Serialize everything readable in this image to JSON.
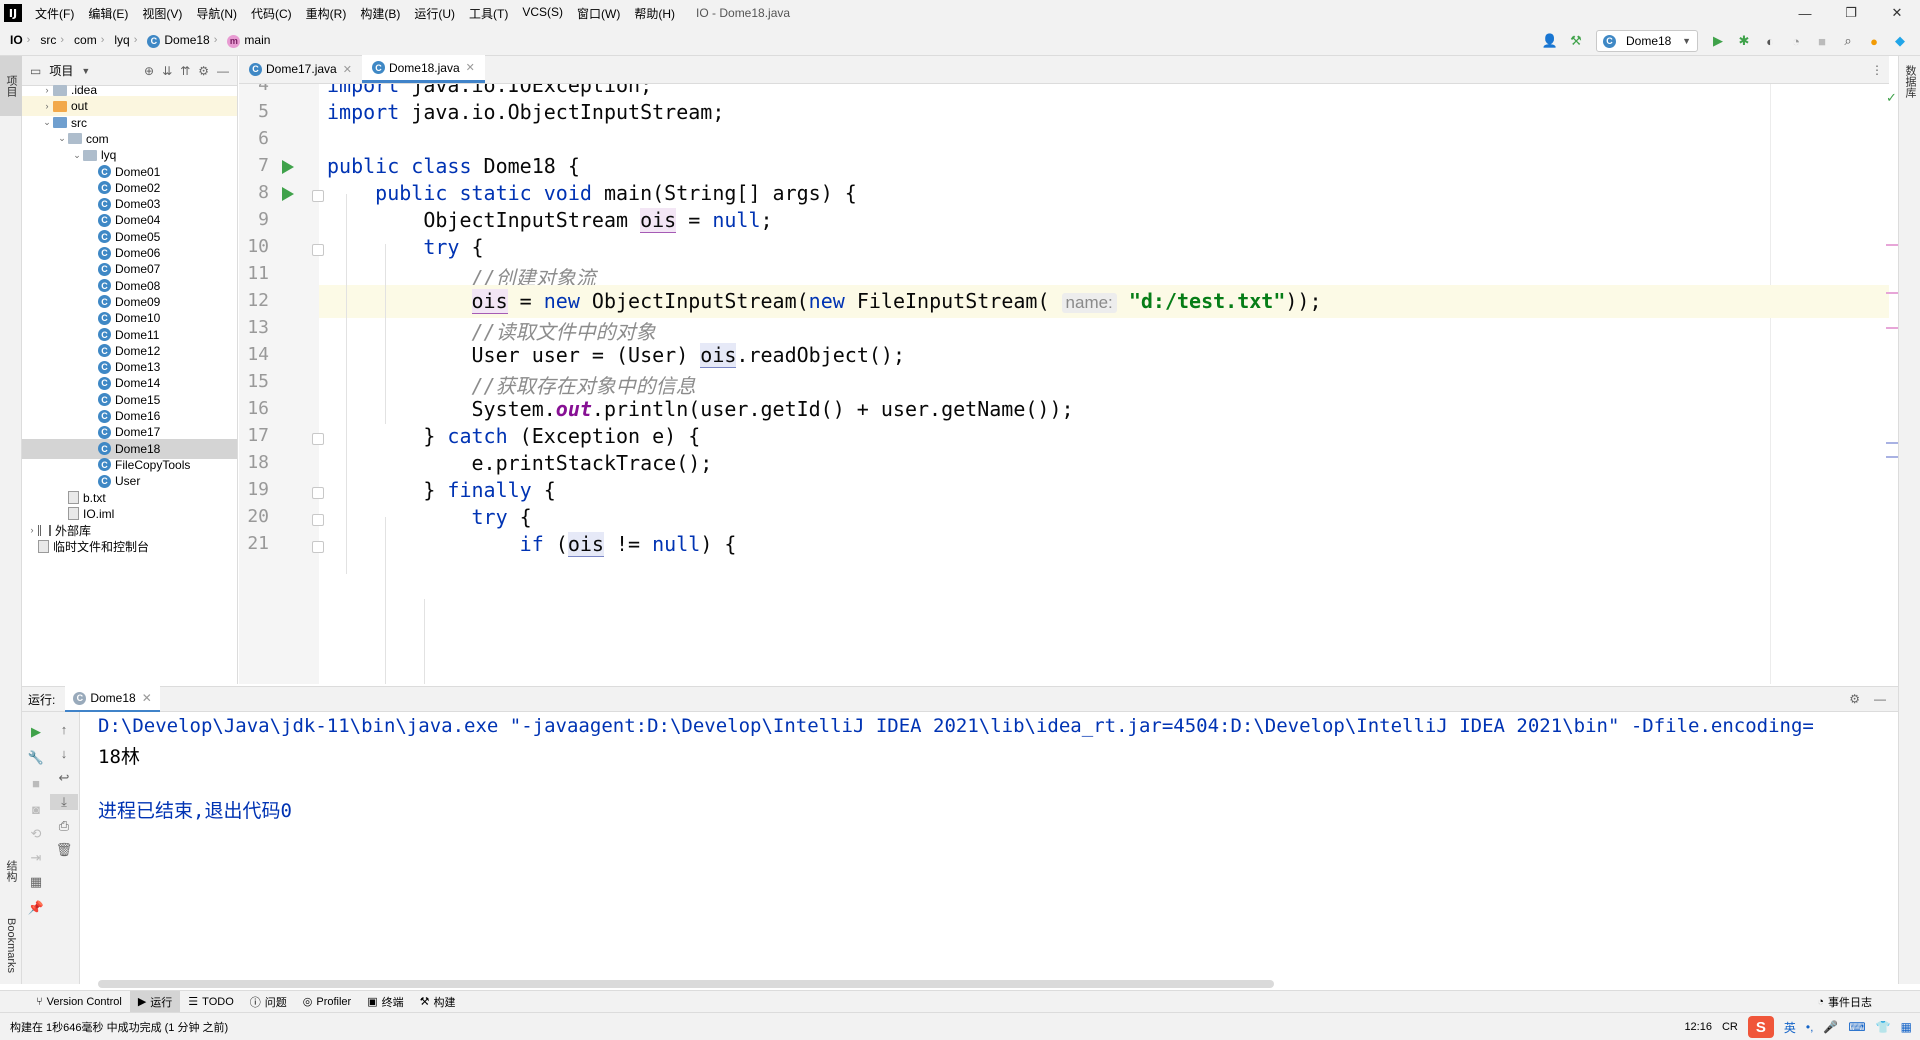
{
  "app": {
    "logo": "IJ",
    "title": "IO - Dome18.java"
  },
  "menu": [
    "文件(F)",
    "编辑(E)",
    "视图(V)",
    "导航(N)",
    "代码(C)",
    "重构(R)",
    "构建(B)",
    "运行(U)",
    "工具(T)",
    "VCS(S)",
    "窗口(W)",
    "帮助(H)"
  ],
  "window_controls": {
    "minimize": "—",
    "maximize": "❐",
    "close": "✕"
  },
  "breadcrumb": [
    {
      "label": "IO",
      "icon": "none"
    },
    {
      "label": "src",
      "icon": "none"
    },
    {
      "label": "com",
      "icon": "none"
    },
    {
      "label": "lyq",
      "icon": "none"
    },
    {
      "label": "Dome18",
      "icon": "class-icon"
    },
    {
      "label": "main",
      "icon": "method-icon"
    }
  ],
  "run_config": {
    "label": "Dome18"
  },
  "left_stripe": {
    "project_label": "项目",
    "structure_label": "结构",
    "bookmarks_label": "Bookmarks"
  },
  "right_stripe": {
    "database_label": "数据库"
  },
  "project_panel": {
    "title": "项目",
    "tree": [
      {
        "label": ".idea",
        "kind": "folder",
        "indent": 1,
        "arrow": "›",
        "state": ""
      },
      {
        "label": "out",
        "kind": "folder-orange",
        "indent": 1,
        "arrow": "›",
        "state": "hl"
      },
      {
        "label": "src",
        "kind": "folder-blue",
        "indent": 1,
        "arrow": "⌄",
        "state": ""
      },
      {
        "label": "com",
        "kind": "folder",
        "indent": 2,
        "arrow": "⌄",
        "state": ""
      },
      {
        "label": "lyq",
        "kind": "folder",
        "indent": 3,
        "arrow": "⌄",
        "state": ""
      },
      {
        "label": "Dome01",
        "kind": "class",
        "indent": 4,
        "arrow": "",
        "state": ""
      },
      {
        "label": "Dome02",
        "kind": "class",
        "indent": 4,
        "arrow": "",
        "state": ""
      },
      {
        "label": "Dome03",
        "kind": "class",
        "indent": 4,
        "arrow": "",
        "state": ""
      },
      {
        "label": "Dome04",
        "kind": "class",
        "indent": 4,
        "arrow": "",
        "state": ""
      },
      {
        "label": "Dome05",
        "kind": "class",
        "indent": 4,
        "arrow": "",
        "state": ""
      },
      {
        "label": "Dome06",
        "kind": "class",
        "indent": 4,
        "arrow": "",
        "state": ""
      },
      {
        "label": "Dome07",
        "kind": "class",
        "indent": 4,
        "arrow": "",
        "state": ""
      },
      {
        "label": "Dome08",
        "kind": "class",
        "indent": 4,
        "arrow": "",
        "state": ""
      },
      {
        "label": "Dome09",
        "kind": "class",
        "indent": 4,
        "arrow": "",
        "state": ""
      },
      {
        "label": "Dome10",
        "kind": "class",
        "indent": 4,
        "arrow": "",
        "state": ""
      },
      {
        "label": "Dome11",
        "kind": "class",
        "indent": 4,
        "arrow": "",
        "state": ""
      },
      {
        "label": "Dome12",
        "kind": "class",
        "indent": 4,
        "arrow": "",
        "state": ""
      },
      {
        "label": "Dome13",
        "kind": "class",
        "indent": 4,
        "arrow": "",
        "state": ""
      },
      {
        "label": "Dome14",
        "kind": "class",
        "indent": 4,
        "arrow": "",
        "state": ""
      },
      {
        "label": "Dome15",
        "kind": "class",
        "indent": 4,
        "arrow": "",
        "state": ""
      },
      {
        "label": "Dome16",
        "kind": "class",
        "indent": 4,
        "arrow": "",
        "state": ""
      },
      {
        "label": "Dome17",
        "kind": "class",
        "indent": 4,
        "arrow": "",
        "state": ""
      },
      {
        "label": "Dome18",
        "kind": "class",
        "indent": 4,
        "arrow": "",
        "state": "sel"
      },
      {
        "label": "FileCopyTools",
        "kind": "class",
        "indent": 4,
        "arrow": "",
        "state": ""
      },
      {
        "label": "User",
        "kind": "class",
        "indent": 4,
        "arrow": "",
        "state": ""
      },
      {
        "label": "b.txt",
        "kind": "file",
        "indent": 2,
        "arrow": "",
        "state": ""
      },
      {
        "label": "IO.iml",
        "kind": "file",
        "indent": 2,
        "arrow": "",
        "state": ""
      },
      {
        "label": "外部库",
        "kind": "lib",
        "indent": 0,
        "arrow": "›",
        "state": ""
      },
      {
        "label": "临时文件和控制台",
        "kind": "scratch",
        "indent": 0,
        "arrow": "",
        "state": ""
      }
    ]
  },
  "editor_tabs": [
    {
      "label": "Dome17.java",
      "active": false
    },
    {
      "label": "Dome18.java",
      "active": true
    }
  ],
  "editor": {
    "current_line": 12,
    "lines": [
      {
        "n": "4",
        "run": false,
        "fold": false,
        "html": "<span class=\"kw\">import</span> java.io.IOException;"
      },
      {
        "n": "5",
        "run": false,
        "fold": false,
        "html": "<span class=\"kw\">import</span> java.io.ObjectInputStream;"
      },
      {
        "n": "6",
        "run": false,
        "fold": false,
        "html": ""
      },
      {
        "n": "7",
        "run": true,
        "fold": false,
        "html": "<span class=\"kw\">public class</span> Dome18 {"
      },
      {
        "n": "8",
        "run": true,
        "fold": true,
        "html": "    <span class=\"kw\">public static void</span> main(String[] args) {"
      },
      {
        "n": "9",
        "run": false,
        "fold": false,
        "html": "        ObjectInputStream <span class=\"var\">ois</span> = <span class=\"kw\">null</span>;"
      },
      {
        "n": "10",
        "run": false,
        "fold": true,
        "html": "        <span class=\"kw\">try</span> {"
      },
      {
        "n": "11",
        "run": false,
        "fold": false,
        "html": "            <span class=\"cm\">//创建对象流</span>"
      },
      {
        "n": "12",
        "run": false,
        "fold": false,
        "html": "            <span class=\"var\">ois</span> = <span class=\"kw\">new</span> ObjectInputStream(<span class=\"kw\">new</span> FileInputStream( <span class=\"hint\">name:</span> <span class=\"str\">\"d:/test.txt\"</span>));"
      },
      {
        "n": "13",
        "run": false,
        "fold": false,
        "html": "            <span class=\"cm\">//读取文件中的对象</span>"
      },
      {
        "n": "14",
        "run": false,
        "fold": false,
        "html": "            User user = (User) <span class=\"var2\">ois</span>.readObject();"
      },
      {
        "n": "15",
        "run": false,
        "fold": false,
        "html": "            <span class=\"cm\">//获取存在对象中的信息</span>"
      },
      {
        "n": "16",
        "run": false,
        "fold": false,
        "html": "            System.<span class=\"it\">out</span>.println(user.getId() + user.getName());"
      },
      {
        "n": "17",
        "run": false,
        "fold": true,
        "html": "        } <span class=\"kw\">catch</span> (Exception e) {"
      },
      {
        "n": "18",
        "run": false,
        "fold": false,
        "html": "            e.printStackTrace();"
      },
      {
        "n": "19",
        "run": false,
        "fold": true,
        "html": "        } <span class=\"kw\">finally</span> {"
      },
      {
        "n": "20",
        "run": false,
        "fold": true,
        "html": "            <span class=\"kw\">try</span> {"
      },
      {
        "n": "21",
        "run": false,
        "fold": true,
        "html": "                <span class=\"kw\">if</span> (<span class=\"var2\">ois</span> != <span class=\"kw\">null</span>) {"
      }
    ]
  },
  "run_panel": {
    "label": "运行:",
    "tab_label": "Dome18",
    "console_lines": [
      {
        "text": "D:\\Develop\\Java\\jdk-11\\bin\\java.exe \"-javaagent:D:\\Develop\\IntelliJ IDEA 2021\\lib\\idea_rt.jar=4504:D:\\Develop\\IntelliJ IDEA 2021\\bin\" -Dfile.encoding=",
        "style": "blue"
      },
      {
        "text": "18林",
        "style": ""
      },
      {
        "text": "",
        "style": ""
      },
      {
        "text": "进程已结束,退出代码0",
        "style": "blue"
      }
    ]
  },
  "tool_windows": [
    {
      "label": "Version Control",
      "icon": "⑂",
      "active": false
    },
    {
      "label": "运行",
      "icon": "▶",
      "active": true
    },
    {
      "label": "TODO",
      "icon": "☰",
      "active": false
    },
    {
      "label": "问题",
      "icon": "ⓘ",
      "active": false
    },
    {
      "label": "Profiler",
      "icon": "◎",
      "active": false
    },
    {
      "label": "终端",
      "icon": "▣",
      "active": false
    },
    {
      "label": "构建",
      "icon": "⚒",
      "active": false
    }
  ],
  "status": {
    "message": "构建在 1秒646毫秒 中成功完成 (1 分钟 之前)",
    "position": "12:16",
    "line_sep": "CR",
    "event_log": "事件日志",
    "ime_lang": "英"
  }
}
